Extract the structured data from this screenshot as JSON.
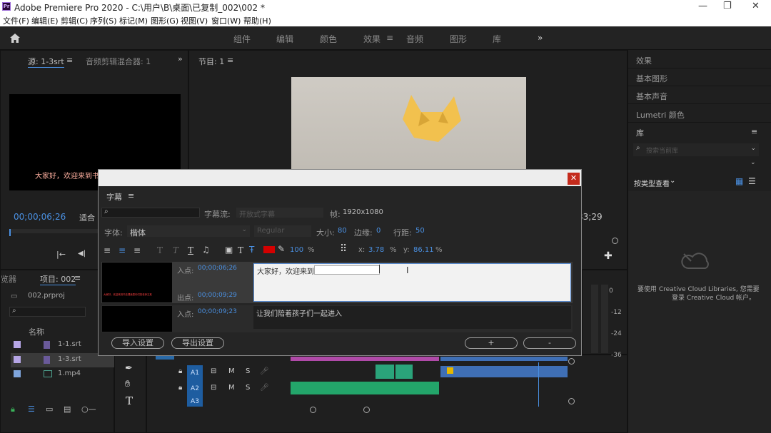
{
  "app": {
    "title": "Adobe Premiere Pro 2020 - C:\\用户\\B\\桌面\\已复制_002\\002 *",
    "logo": "Pr"
  },
  "menu": [
    "文件(F)",
    "编辑(E)",
    "剪辑(C)",
    "序列(S)",
    "标记(M)",
    "图形(G)",
    "视图(V)",
    "窗口(W)",
    "帮助(H)"
  ],
  "workspaces": [
    "组件",
    "编辑",
    "颜色",
    "效果",
    "音频",
    "图形",
    "库"
  ],
  "source_panel": {
    "tab1": "源: 1-3srt",
    "tab2": "音频剪辑混合器: 1",
    "timecode": "00;00;06;26",
    "fit": "适合",
    "subtitle_preview": "大家好，欢迎来到书"
  },
  "program_panel": {
    "title": "节目: 1",
    "timecode_right": "33;29"
  },
  "project_panel": {
    "tab1": "项目: 002",
    "tab0": "览器",
    "file": "002.prproj",
    "col_name": "名称",
    "items": [
      "1-1.srt",
      "1-3.srt",
      "1.mp4"
    ]
  },
  "dialog": {
    "panel_title": "字幕",
    "stream_label": "字幕流:",
    "stream_value": "开放式字幕",
    "frame_label": "帧:",
    "frame_value": "1920x1080",
    "font_label": "字体:",
    "font_value": "楷体",
    "style_value": "Regular",
    "size_label": "大小:",
    "size_value": "80",
    "edge_label": "边缘:",
    "edge_value": "0",
    "line_label": "行距:",
    "line_value": "50",
    "opacity_value": "100",
    "pct": "%",
    "x_label": "x:",
    "x_value": "3.78",
    "y_label": "y:",
    "y_value": "86.11",
    "rows": [
      {
        "in_label": "入点:",
        "in_value": "00;00;06;26",
        "out_label": "出点:",
        "out_value": "00;00;09;29",
        "text": "大家好，欢迎来到",
        "thumb_text": "大家好，欢迎来到书法课我是你们的老师王某"
      },
      {
        "in_label": "入点:",
        "in_value": "00;00;09;23",
        "text": "让我们陪着孩子们一起进入"
      }
    ],
    "import_btn": "导入设置",
    "export_btn": "导出设置",
    "add_btn": "+",
    "remove_btn": "-"
  },
  "right_panel": {
    "items": [
      "效果",
      "基本图形",
      "基本声音",
      "Lumetri 颜色",
      "库"
    ],
    "search_placeholder": "搜索当前库",
    "view_label": "按类型查看",
    "cc_message1": "要使用 Creative Cloud Libraries, 您需要",
    "cc_message2": "登录 Creative Cloud 帐户。"
  },
  "timeline": {
    "tracks": [
      "A1",
      "A2",
      "A3"
    ],
    "m": "M",
    "s": "S",
    "meter_labels": [
      "0",
      "-12",
      "-24",
      "-36"
    ]
  }
}
